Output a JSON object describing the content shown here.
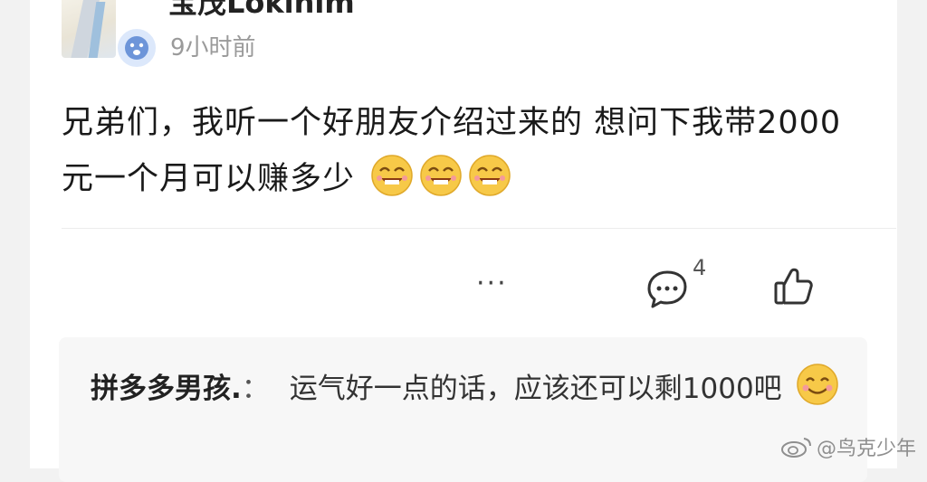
{
  "post": {
    "username": "宝茂Lokihim",
    "time": "9小时前",
    "text": "兄弟们，我听一个好朋友介绍过来的 想问下我带2000元一个月可以赚多少",
    "emoji_count": 3
  },
  "actions": {
    "more": "···",
    "comment_count": "4"
  },
  "reply": {
    "author": "拼多多男孩.",
    "separator": "：",
    "text": "运气好一点的话，应该还可以剩1000吧"
  },
  "watermark": {
    "text": "@鸟克少年"
  },
  "icons": [
    "avatar-image",
    "vip-badge-icon",
    "money-face-emoji",
    "comment-icon",
    "thumbs-up-icon",
    "smile-emoji",
    "weibo-icon"
  ]
}
